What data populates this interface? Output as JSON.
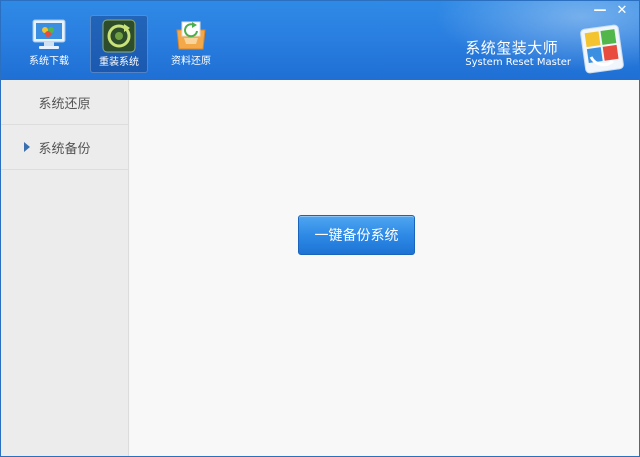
{
  "toolbar": {
    "items": [
      {
        "label": "系统下载",
        "icon": "monitor-download-icon",
        "active": false
      },
      {
        "label": "重装系统",
        "icon": "reinstall-refresh-icon",
        "active": true
      },
      {
        "label": "资料还原",
        "icon": "data-restore-icon",
        "active": false
      }
    ]
  },
  "window_controls": {
    "minimize": "—",
    "close": "✕"
  },
  "brand": {
    "title_cn": "系统玺装大师",
    "title_en": "System Reset Master",
    "logo_icon": "brand-logo-icon"
  },
  "sidebar": {
    "items": [
      {
        "label": "系统还原",
        "selected": false
      },
      {
        "label": "系统备份",
        "selected": true
      }
    ]
  },
  "main": {
    "backup_button_label": "一键备份系统"
  },
  "colors": {
    "header_blue": "#2a7fe0",
    "button_blue": "#2e8ae6",
    "sidebar_bg": "#ececec",
    "main_bg": "#f8f8f8"
  }
}
